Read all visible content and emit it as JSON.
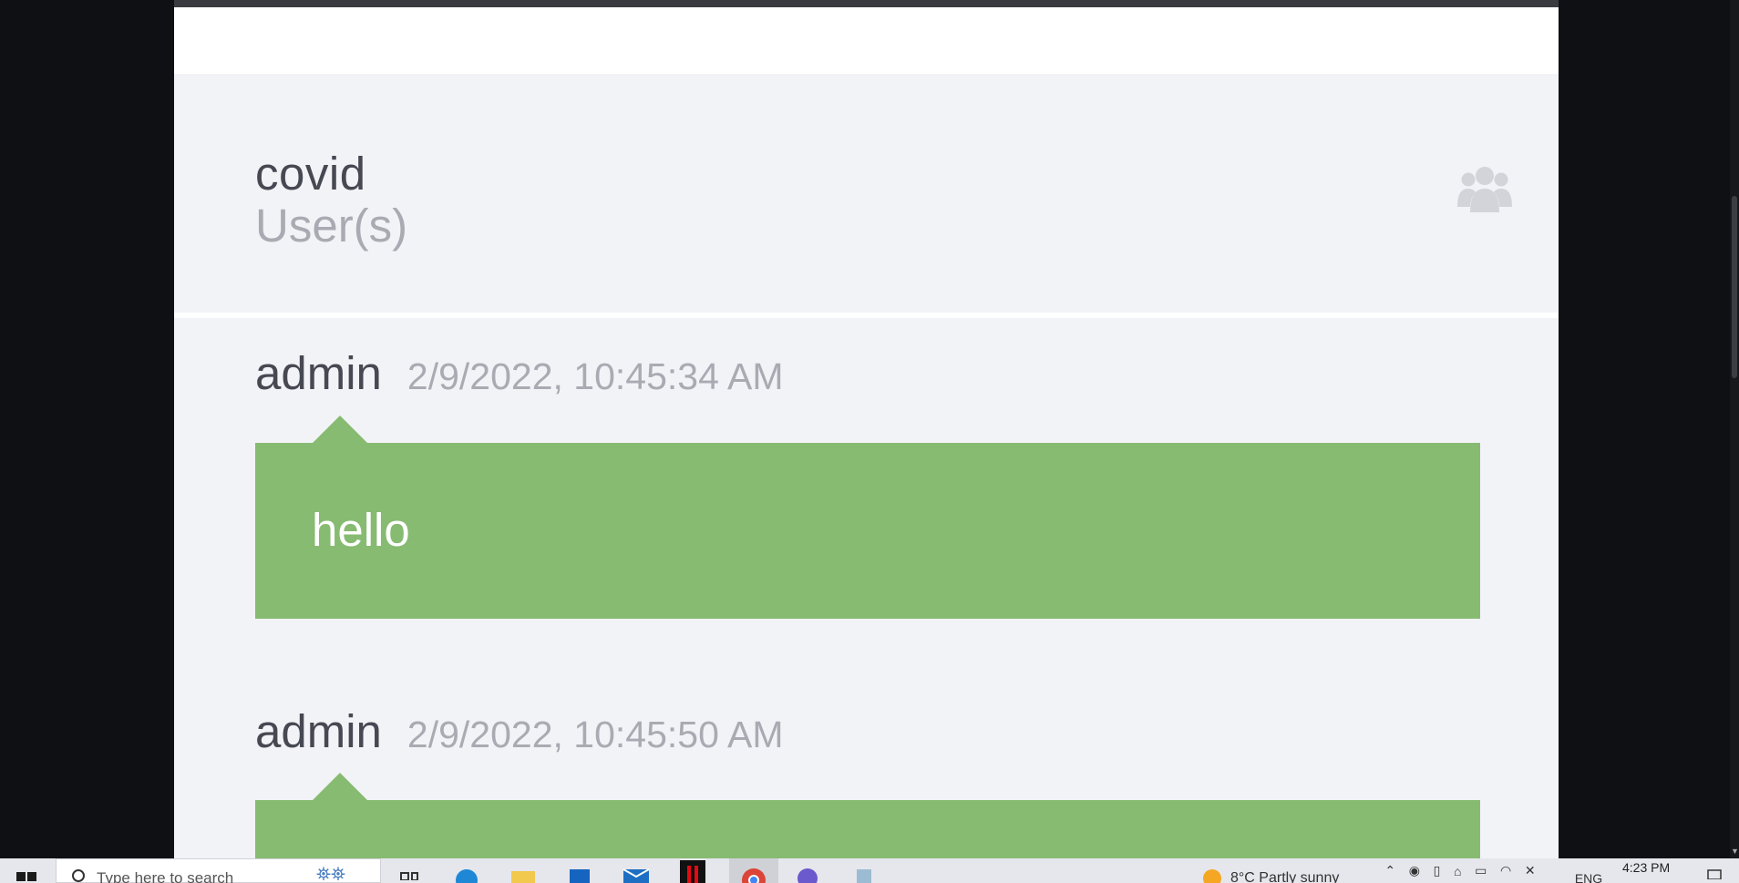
{
  "room": {
    "name": "covid",
    "subtitle": "User(s)",
    "users_icon": "users-group-icon"
  },
  "messages": [
    {
      "author": "admin",
      "timestamp": "2/9/2022, 10:45:34 AM",
      "text": "hello"
    },
    {
      "author": "admin",
      "timestamp": "2/9/2022, 10:45:50 AM",
      "text": ""
    }
  ],
  "colors": {
    "bubble": "#87bb71",
    "page_bg": "#f2f3f7",
    "outer_bg": "#0f1014"
  },
  "taskbar": {
    "search_placeholder": "Type here to search",
    "weather": "8°C  Partly sunny",
    "language": "ENG",
    "time": "4:23 PM",
    "apps": [
      "task-view-icon",
      "edge-icon",
      "file-explorer-icon",
      "store-icon",
      "mail-icon",
      "netflix-icon",
      "chrome-icon",
      "app-icon",
      "notepad-icon"
    ]
  }
}
